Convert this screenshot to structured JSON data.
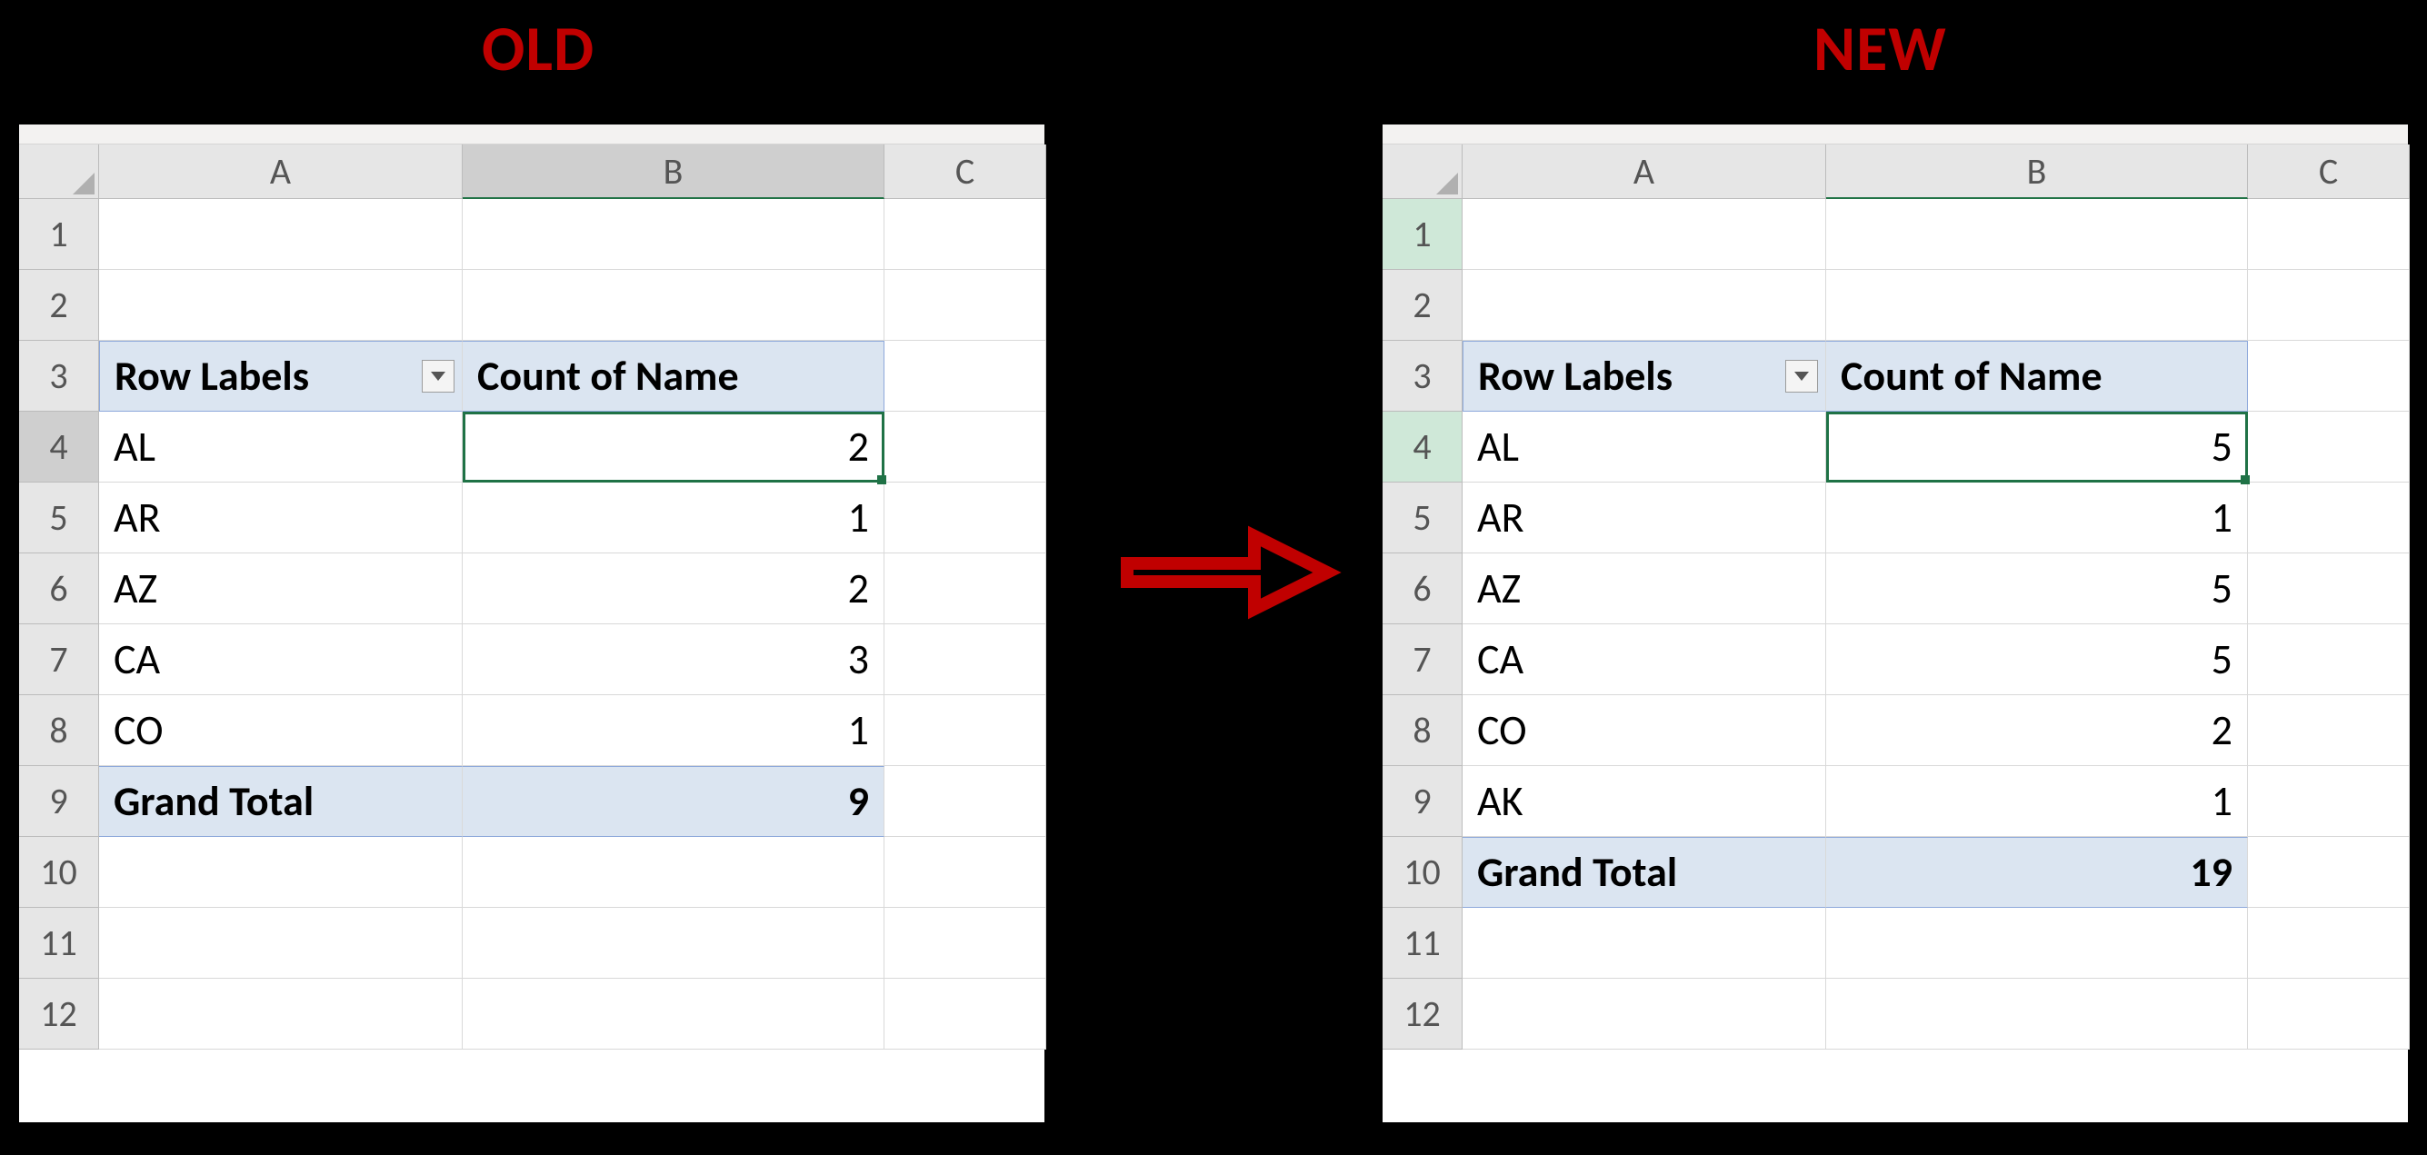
{
  "titles": {
    "old": "OLD",
    "new": "NEW"
  },
  "columns": [
    "A",
    "B",
    "C"
  ],
  "old": {
    "rowCount": 12,
    "pivotHeader": {
      "row": 3,
      "rowLabels": "Row Labels",
      "countLabel": "Count of Name"
    },
    "data": [
      {
        "row": 4,
        "label": "AL",
        "count": "2"
      },
      {
        "row": 5,
        "label": "AR",
        "count": "1"
      },
      {
        "row": 6,
        "label": "AZ",
        "count": "2"
      },
      {
        "row": 7,
        "label": "CA",
        "count": "3"
      },
      {
        "row": 8,
        "label": "CO",
        "count": "1"
      }
    ],
    "grandTotal": {
      "row": 9,
      "label": "Grand Total",
      "value": "9"
    },
    "activeCell": "B4",
    "selectedRowHeader": 4
  },
  "new": {
    "rowCount": 12,
    "pivotHeader": {
      "row": 3,
      "rowLabels": "Row Labels",
      "countLabel": "Count of Name"
    },
    "data": [
      {
        "row": 4,
        "label": "AL",
        "count": "5"
      },
      {
        "row": 5,
        "label": "AR",
        "count": "1"
      },
      {
        "row": 6,
        "label": "AZ",
        "count": "5"
      },
      {
        "row": 7,
        "label": "CA",
        "count": "5"
      },
      {
        "row": 8,
        "label": "CO",
        "count": "2"
      },
      {
        "row": 9,
        "label": "AK",
        "count": "1"
      }
    ],
    "grandTotal": {
      "row": 10,
      "label": "Grand Total",
      "value": "19"
    },
    "activeCell": "B4",
    "selectedRowHeader": 4,
    "highlightRow1": true
  }
}
